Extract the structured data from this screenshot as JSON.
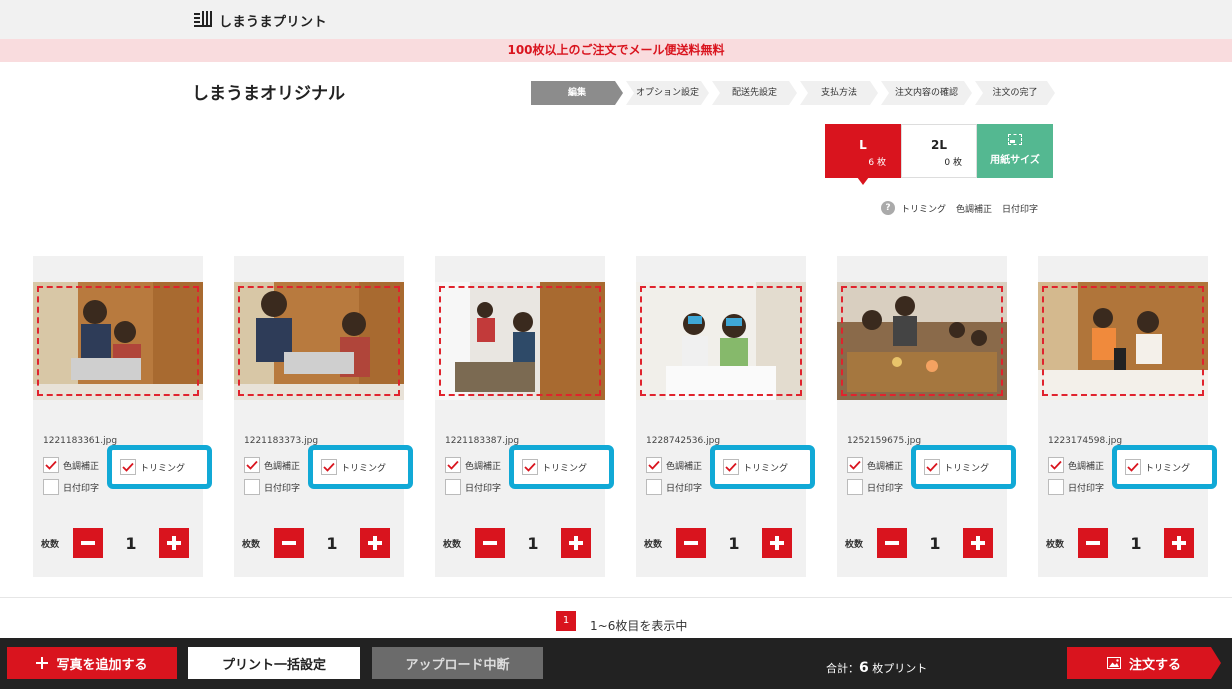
{
  "header": {
    "logo_text": "しまうまプリント",
    "promo": "100枚以上のご注文でメール便送料無料"
  },
  "page_title": "しまうまオリジナル",
  "steps": [
    {
      "label": "編集",
      "active": true
    },
    {
      "label": "オプション設定",
      "active": false
    },
    {
      "label": "配送先設定",
      "active": false
    },
    {
      "label": "支払方法",
      "active": false
    },
    {
      "label": "注文内容の確認",
      "active": false
    },
    {
      "label": "注文の完了",
      "active": false
    }
  ],
  "size_tabs": [
    {
      "label": "L",
      "count": "6 枚",
      "active": true
    },
    {
      "label": "2L",
      "count": "0 枚",
      "active": false
    }
  ],
  "paper_size_label": "用紙サイズ",
  "legend": {
    "help": "?",
    "items": [
      "トリミング",
      "色調補正",
      "日付印字"
    ]
  },
  "option_labels": {
    "color": "色調補正",
    "trim": "トリミング",
    "date": "日付印字",
    "qty": "枚数"
  },
  "photos": [
    {
      "filename": "1221183361.jpg",
      "color_checked": true,
      "trim_checked": true,
      "date_checked": false,
      "qty": "1"
    },
    {
      "filename": "1221183373.jpg",
      "color_checked": true,
      "trim_checked": true,
      "date_checked": false,
      "qty": "1"
    },
    {
      "filename": "1221183387.jpg",
      "color_checked": true,
      "trim_checked": true,
      "date_checked": false,
      "qty": "1"
    },
    {
      "filename": "1228742536.jpg",
      "color_checked": true,
      "trim_checked": true,
      "date_checked": false,
      "qty": "1"
    },
    {
      "filename": "1252159675.jpg",
      "color_checked": true,
      "trim_checked": true,
      "date_checked": false,
      "qty": "1"
    },
    {
      "filename": "1223174598.jpg",
      "color_checked": true,
      "trim_checked": true,
      "date_checked": false,
      "qty": "1"
    }
  ],
  "pager": {
    "current": "1",
    "text": "1~6枚目を表示中"
  },
  "footer": {
    "add_photo": "写真を追加する",
    "bulk_settings": "プリント一括設定",
    "abort_upload": "アップロード中断",
    "total_prefix": "合計：",
    "total_count": "6",
    "total_suffix": " 枚プリント",
    "order": "注文する"
  },
  "colors": {
    "accent": "#d9141e",
    "promo_bg": "#f9dcde",
    "paper_green": "#54b891",
    "highlight": "#11a9d6",
    "footer_bg": "#222222"
  }
}
